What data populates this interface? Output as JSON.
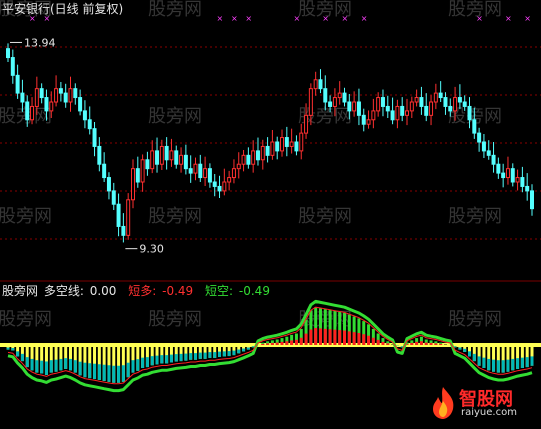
{
  "main_title": "平安银行(日线 前复权)",
  "indicator": {
    "name": "股旁网",
    "line1_label": "多空线:",
    "line1_value": "0.00",
    "line2_label": "短多:",
    "line2_value": "-0.49",
    "line3_label": "短空:",
    "line3_value": "-0.49"
  },
  "annotations": {
    "high_label": "13.94",
    "low_label": "9.30"
  },
  "watermark": "股旁网",
  "logo": {
    "text": "智股网",
    "url": "raiyue.com"
  },
  "colors": {
    "up": "#ff3030",
    "down": "#54ffff",
    "grid": "#8a0000",
    "yellow": "#ffff54",
    "green": "#33dd33",
    "red": "#ff2020",
    "cyan": "#00b8b8",
    "magenta": "#ff40ff",
    "white": "#e6e6e6"
  },
  "chart_data": [
    {
      "type": "candlestick",
      "title": "平安银行(日线 前复权)",
      "high": 13.94,
      "low": 9.3,
      "close": [
        13.6,
        13.2,
        12.8,
        12.6,
        12.2,
        12.5,
        12.9,
        12.7,
        12.4,
        12.6,
        12.9,
        12.8,
        12.6,
        12.9,
        12.7,
        12.4,
        12.2,
        12.0,
        11.6,
        11.2,
        10.9,
        10.6,
        10.3,
        9.8,
        9.6,
        10.4,
        11.1,
        10.8,
        11.3,
        11.1,
        11.5,
        11.2,
        11.6,
        11.3,
        11.5,
        11.2,
        11.4,
        11.1,
        11.0,
        11.2,
        10.9,
        11.1,
        10.8,
        10.7,
        10.6,
        10.8,
        10.9,
        11.1,
        11.2,
        11.4,
        11.2,
        11.5,
        11.3,
        11.6,
        11.4,
        11.7,
        11.5,
        11.8,
        11.6,
        11.7,
        11.5,
        11.9,
        12.3,
        12.9,
        13.1,
        12.9,
        12.6,
        12.5,
        12.7,
        12.8,
        12.6,
        12.4,
        12.6,
        12.3,
        12.1,
        12.2,
        12.4,
        12.7,
        12.5,
        12.4,
        12.2,
        12.5,
        12.3,
        12.4,
        12.6,
        12.7,
        12.5,
        12.3,
        12.6,
        12.8,
        12.7,
        12.5,
        12.4,
        12.7,
        12.6,
        12.5,
        12.2,
        11.9,
        11.7,
        11.5,
        11.4,
        11.2,
        11.0,
        10.9,
        11.1,
        10.8,
        10.9,
        10.7,
        10.6,
        10.2
      ],
      "ylim": [
        9.0,
        14.4
      ]
    },
    {
      "type": "bar+line",
      "title": "股旁网",
      "series": [
        {
          "name": "多空线",
          "values": [
            0.0
          ]
        },
        {
          "name": "短多",
          "values": [
            -0.49
          ]
        },
        {
          "name": "短空",
          "values": [
            -0.49
          ]
        }
      ],
      "histogram": [
        -0.1,
        -0.12,
        -0.25,
        -0.35,
        -0.48,
        -0.55,
        -0.6,
        -0.62,
        -0.65,
        -0.6,
        -0.58,
        -0.55,
        -0.52,
        -0.55,
        -0.6,
        -0.66,
        -0.7,
        -0.72,
        -0.74,
        -0.76,
        -0.78,
        -0.8,
        -0.82,
        -0.82,
        -0.8,
        -0.7,
        -0.6,
        -0.56,
        -0.5,
        -0.48,
        -0.44,
        -0.42,
        -0.4,
        -0.4,
        -0.38,
        -0.36,
        -0.35,
        -0.34,
        -0.32,
        -0.32,
        -0.3,
        -0.3,
        -0.28,
        -0.28,
        -0.26,
        -0.25,
        -0.24,
        -0.22,
        -0.18,
        -0.14,
        -0.1,
        -0.05,
        0.0,
        0.05,
        0.08,
        0.1,
        0.12,
        0.15,
        0.18,
        0.22,
        0.25,
        0.35,
        0.55,
        0.75,
        0.82,
        0.8,
        0.78,
        0.76,
        0.74,
        0.72,
        0.7,
        0.66,
        0.62,
        0.58,
        0.52,
        0.45,
        0.35,
        0.25,
        0.15,
        0.08,
        0.02,
        -0.02,
        -0.05,
        0.05,
        0.1,
        0.15,
        0.18,
        0.12,
        0.1,
        0.08,
        0.05,
        0.02,
        0.0,
        -0.05,
        -0.1,
        -0.15,
        -0.25,
        -0.35,
        -0.45,
        -0.5,
        -0.55,
        -0.58,
        -0.6,
        -0.6,
        -0.58,
        -0.55,
        -0.52,
        -0.5,
        -0.48,
        -0.45
      ]
    }
  ]
}
